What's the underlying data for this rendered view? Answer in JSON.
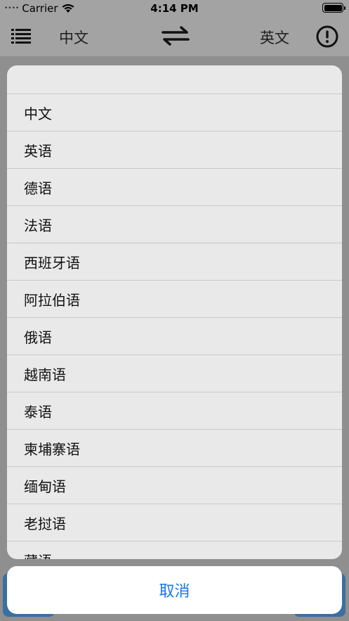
{
  "status_bar": {
    "signal_dots": "••••",
    "carrier": "Carrier",
    "time": "4:14 PM",
    "icons": [
      "wifi-icon",
      "battery-icon"
    ]
  },
  "nav": {
    "menu_icon": "list-icon",
    "source_language": "中文",
    "swap_icon": "swap-arrows-icon",
    "target_language": "英文",
    "info_icon": "exclamation-circle-icon"
  },
  "language_sheet": {
    "options": [
      "中文",
      "英语",
      "德语",
      "法语",
      "西班牙语",
      "阿拉伯语",
      "俄语",
      "越南语",
      "泰语",
      "柬埔寨语",
      "缅甸语",
      "老挝语",
      "藏语"
    ],
    "cancel_label": "取消"
  },
  "colors": {
    "accent": "#1877e8",
    "overlay": "#8e8e8e",
    "sheet_bg": "#e9e9e9",
    "background_button": "#3a6fa2"
  }
}
